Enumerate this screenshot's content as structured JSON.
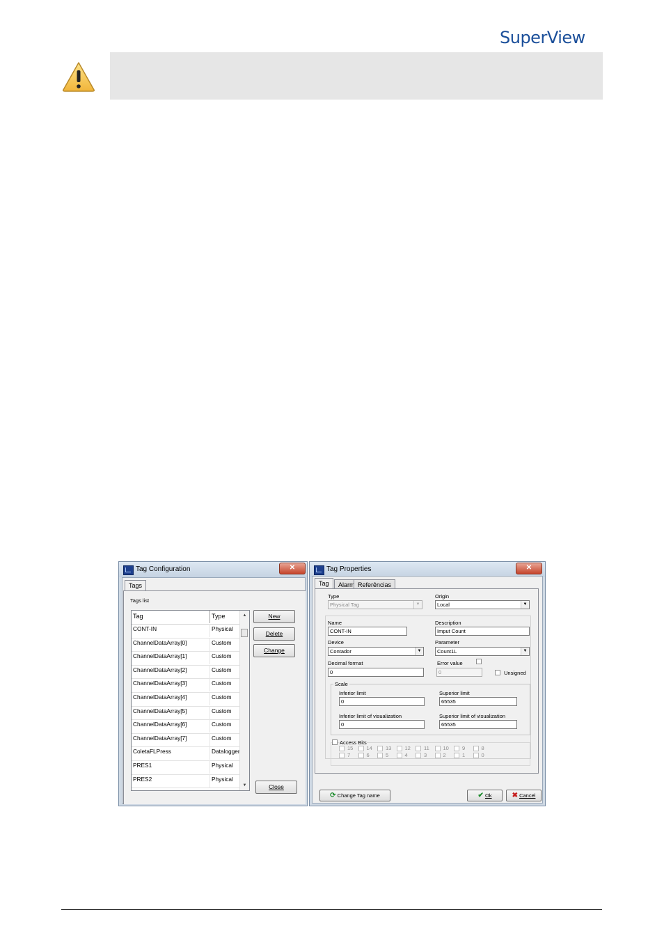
{
  "header": {
    "logo_text": "SuperView"
  },
  "warning": {
    "icon": "warning-icon"
  },
  "tag_config": {
    "title": "Tag Configuration",
    "close": "✕",
    "tab": "Tags",
    "list_label": "Tags list",
    "columns": [
      "Tag",
      "Type"
    ],
    "rows": [
      {
        "tag": "CONT-IN",
        "type": "Physical"
      },
      {
        "tag": "ChannelDataArray[0]",
        "type": "Custom"
      },
      {
        "tag": "ChannelDataArray[1]",
        "type": "Custom"
      },
      {
        "tag": "ChannelDataArray[2]",
        "type": "Custom"
      },
      {
        "tag": "ChannelDataArray[3]",
        "type": "Custom"
      },
      {
        "tag": "ChannelDataArray[4]",
        "type": "Custom"
      },
      {
        "tag": "ChannelDataArray[5]",
        "type": "Custom"
      },
      {
        "tag": "ChannelDataArray[6]",
        "type": "Custom"
      },
      {
        "tag": "ChannelDataArray[7]",
        "type": "Custom"
      },
      {
        "tag": "ColetaFLPress",
        "type": "Datalogger"
      },
      {
        "tag": "PRES1",
        "type": "Physical"
      },
      {
        "tag": "PRES2",
        "type": "Physical"
      }
    ],
    "buttons": {
      "new": "New",
      "delete": "Delete",
      "change": "Change",
      "close": "Close"
    }
  },
  "tag_props": {
    "title": "Tag Properties",
    "close": "✕",
    "tabs": [
      "Tag",
      "Alarm",
      "Referências"
    ],
    "type_label": "Type",
    "type_value": "Physical Tag",
    "origin_label": "Origin",
    "origin_value": "Local",
    "name_label": "Name",
    "name_value": "CONT-IN",
    "description_label": "Description",
    "description_value": "Imput Count",
    "device_label": "Device",
    "device_value": "Contador",
    "parameter_label": "Parameter",
    "parameter_value": "Count1L",
    "decimal_label": "Decimal format",
    "decimal_value": "0",
    "error_label": "Error value",
    "error_value": "0",
    "unsigned_label": "Unsigned",
    "scale_label": "Scale",
    "inferior_label": "Inferior limit",
    "inferior_value": "0",
    "superior_label": "Superior limit",
    "superior_value": "65535",
    "inf_vis_label": "Inferior limit of visualization",
    "inf_vis_value": "0",
    "sup_vis_label": "Superior limit of visualization",
    "sup_vis_value": "65535",
    "access_bits_label": "Access Bits",
    "bits_row1": [
      "15",
      "14",
      "13",
      "12",
      "11",
      "10",
      "9",
      "8"
    ],
    "bits_row2": [
      "7",
      "6",
      "5",
      "4",
      "3",
      "2",
      "1",
      "0"
    ],
    "change_name_btn": "Change Tag name",
    "ok_btn": "Ok",
    "cancel_btn": "Cancel"
  }
}
